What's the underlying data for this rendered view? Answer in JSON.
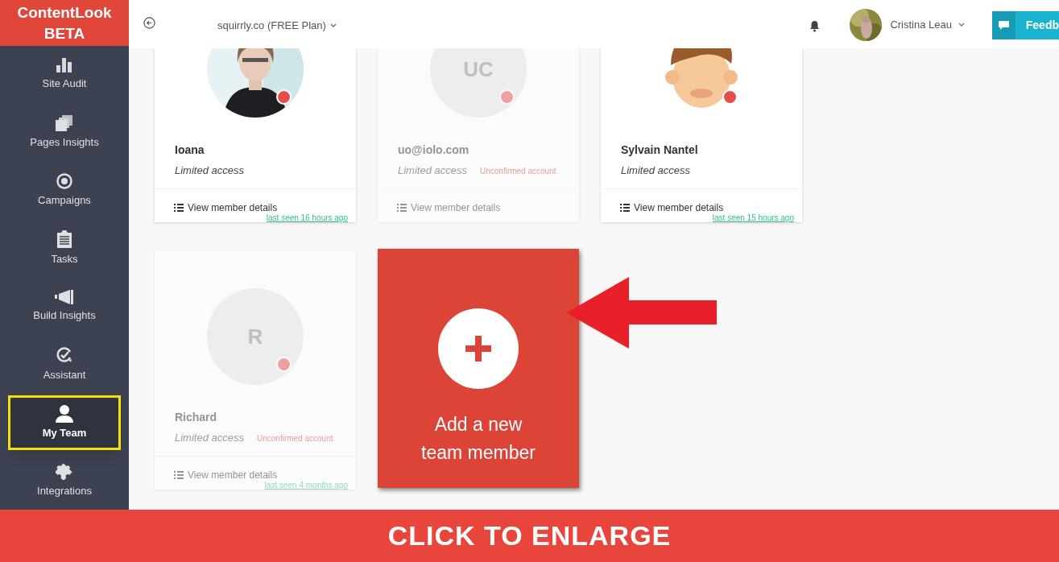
{
  "logo": {
    "name": "ContentLook",
    "badge": "BETA"
  },
  "header": {
    "site": "squirrly.co (FREE Plan)",
    "user": "Cristina Leau",
    "feedback": "Feedb"
  },
  "sidebar": {
    "items": [
      {
        "label": "Site Audit",
        "selected": false
      },
      {
        "label": "Pages Insights",
        "selected": false
      },
      {
        "label": "Campaigns",
        "selected": false
      },
      {
        "label": "Tasks",
        "selected": false
      },
      {
        "label": "Build Insights",
        "selected": false
      },
      {
        "label": "Assistant",
        "selected": false
      },
      {
        "label": "My Team",
        "selected": true
      },
      {
        "label": "Integrations",
        "selected": false
      }
    ]
  },
  "members": [
    {
      "kind": "picture",
      "name": "Ioana",
      "access": "Limited access",
      "confirmed": true,
      "details": "View member details",
      "last_seen": "last seen 16 hours ago"
    },
    {
      "initials": "UC",
      "name": "uo@iolo.com",
      "access": "Limited access",
      "confirmed": false,
      "status": "Unconfirmed account",
      "details": "View member details"
    },
    {
      "kind": "picture",
      "name": "Sylvain Nantel",
      "access": "Limited access",
      "confirmed": true,
      "details": "View member details",
      "last_seen": "last seen 15 hours ago"
    },
    {
      "initials": "R",
      "name": "Richard",
      "access": "Limited access",
      "confirmed": false,
      "status": "Unconfirmed account",
      "details": "View member details",
      "last_seen": "last seen 4 months ago"
    }
  ],
  "add_card": {
    "lines": [
      "Add a new",
      "team member"
    ]
  },
  "banner": "CLICK TO ENLARGE"
}
